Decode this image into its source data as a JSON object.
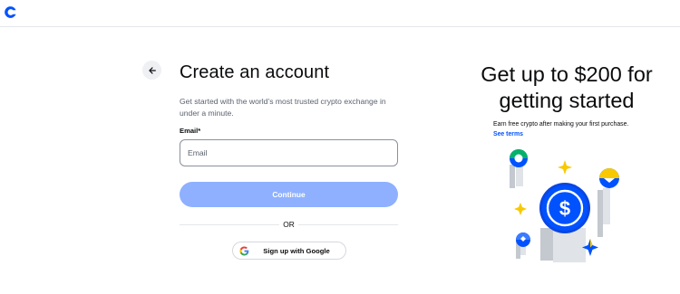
{
  "header": {
    "logo_icon": "coinbase-logo-icon"
  },
  "signup": {
    "back_icon": "arrow-left-icon",
    "title": "Create an account",
    "subtitle": "Get started with the world’s most trusted crypto exchange in under a minute.",
    "email_label": "Email*",
    "email_placeholder": "Email",
    "email_value": "",
    "continue_label": "Continue",
    "divider_label": "OR",
    "google_label": "Sign up with Google",
    "google_icon": "google-g-icon"
  },
  "promo": {
    "title": "Get up to $200 for getting started",
    "text": "Earn free crypto after making your first purchase.",
    "link_label": "See terms",
    "illustration_icon": "crypto-coins-illustration"
  },
  "colors": {
    "brand": "#0052ff",
    "button_disabled": "#8eb0ff",
    "text": "#0a0b0d",
    "muted": "#5b616e"
  }
}
